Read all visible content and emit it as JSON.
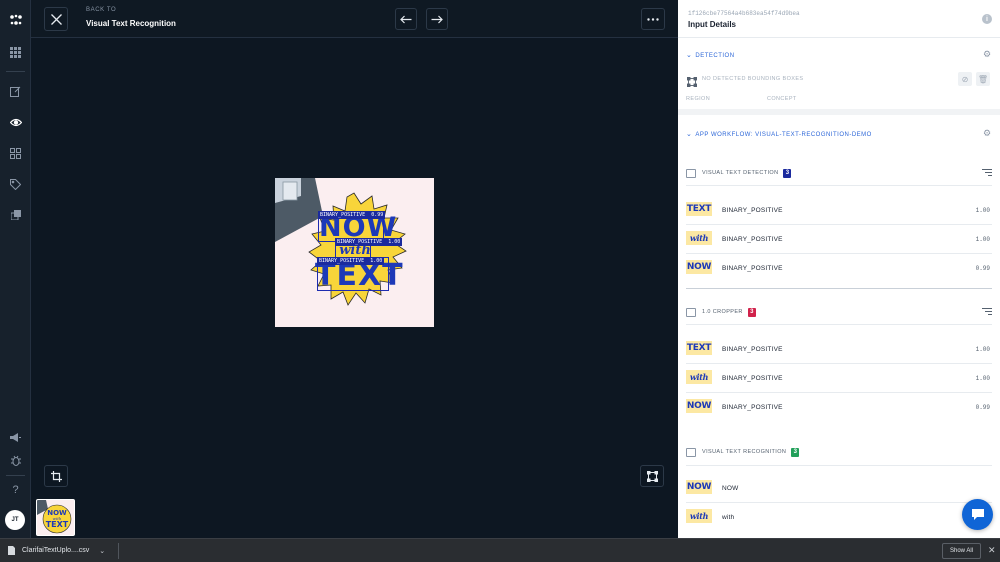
{
  "topbar": {
    "back_to": "BACK TO",
    "app_name": "Visual Text Recognition"
  },
  "user": {
    "initials": "JT"
  },
  "image": {
    "detections": [
      {
        "label": "BINARY_POSITIVE",
        "score": "0.99"
      },
      {
        "label": "BINARY_POSITIVE",
        "score": "1.00"
      },
      {
        "label": "BINARY_POSITIVE",
        "score": "1.00"
      }
    ],
    "sticker_top": "NOW",
    "sticker_mid": "with",
    "sticker_bottom": "TEXT",
    "sticker_color": "#f8d53a",
    "text_color": "#1d39b8"
  },
  "panel": {
    "input_id": "1f126cbe77564a4b683ea54f74d9bea",
    "title": "Input Details",
    "detection": {
      "heading": "DETECTION",
      "no_boxes": "NO DETECTED BOUNDING BOXES",
      "region_col": "REGION",
      "concept_col": "CONCEPT"
    },
    "workflow": {
      "heading": "APP WORKFLOW: VISUAL-TEXT-RECOGNITION-DEMO",
      "models": [
        {
          "name": "VISUAL TEXT DETECTION",
          "count": "3",
          "badge_color": "#1b2a9e",
          "predictions": [
            {
              "thumb": "TEXT",
              "label": "BINARY_POSITIVE",
              "value": "1.00"
            },
            {
              "thumb": "with",
              "label": "BINARY_POSITIVE",
              "value": "1.00"
            },
            {
              "thumb": "NOW",
              "label": "BINARY_POSITIVE",
              "value": "0.99"
            }
          ]
        },
        {
          "name": "1.0 CROPPER",
          "count": "3",
          "badge_color": "#d1224b",
          "predictions": [
            {
              "thumb": "TEXT",
              "label": "BINARY_POSITIVE",
              "value": "1.00"
            },
            {
              "thumb": "with",
              "label": "BINARY_POSITIVE",
              "value": "1.00"
            },
            {
              "thumb": "NOW",
              "label": "BINARY_POSITIVE",
              "value": "0.99"
            }
          ]
        },
        {
          "name": "VISUAL TEXT RECOGNITION",
          "count": "3",
          "badge_color": "#22a05a",
          "predictions": [
            {
              "thumb": "NOW",
              "label": "NOW",
              "value": ""
            },
            {
              "thumb": "with",
              "label": "with",
              "value": ""
            }
          ]
        }
      ]
    }
  },
  "download": {
    "file_name": "ClarifaiTextUplo....csv",
    "show_all": "Show All"
  },
  "icons": {
    "logo": "clarifai-logo-icon",
    "close": "close-icon",
    "prev": "arrow-left-icon",
    "next": "arrow-right-icon",
    "more": "more-icon"
  }
}
